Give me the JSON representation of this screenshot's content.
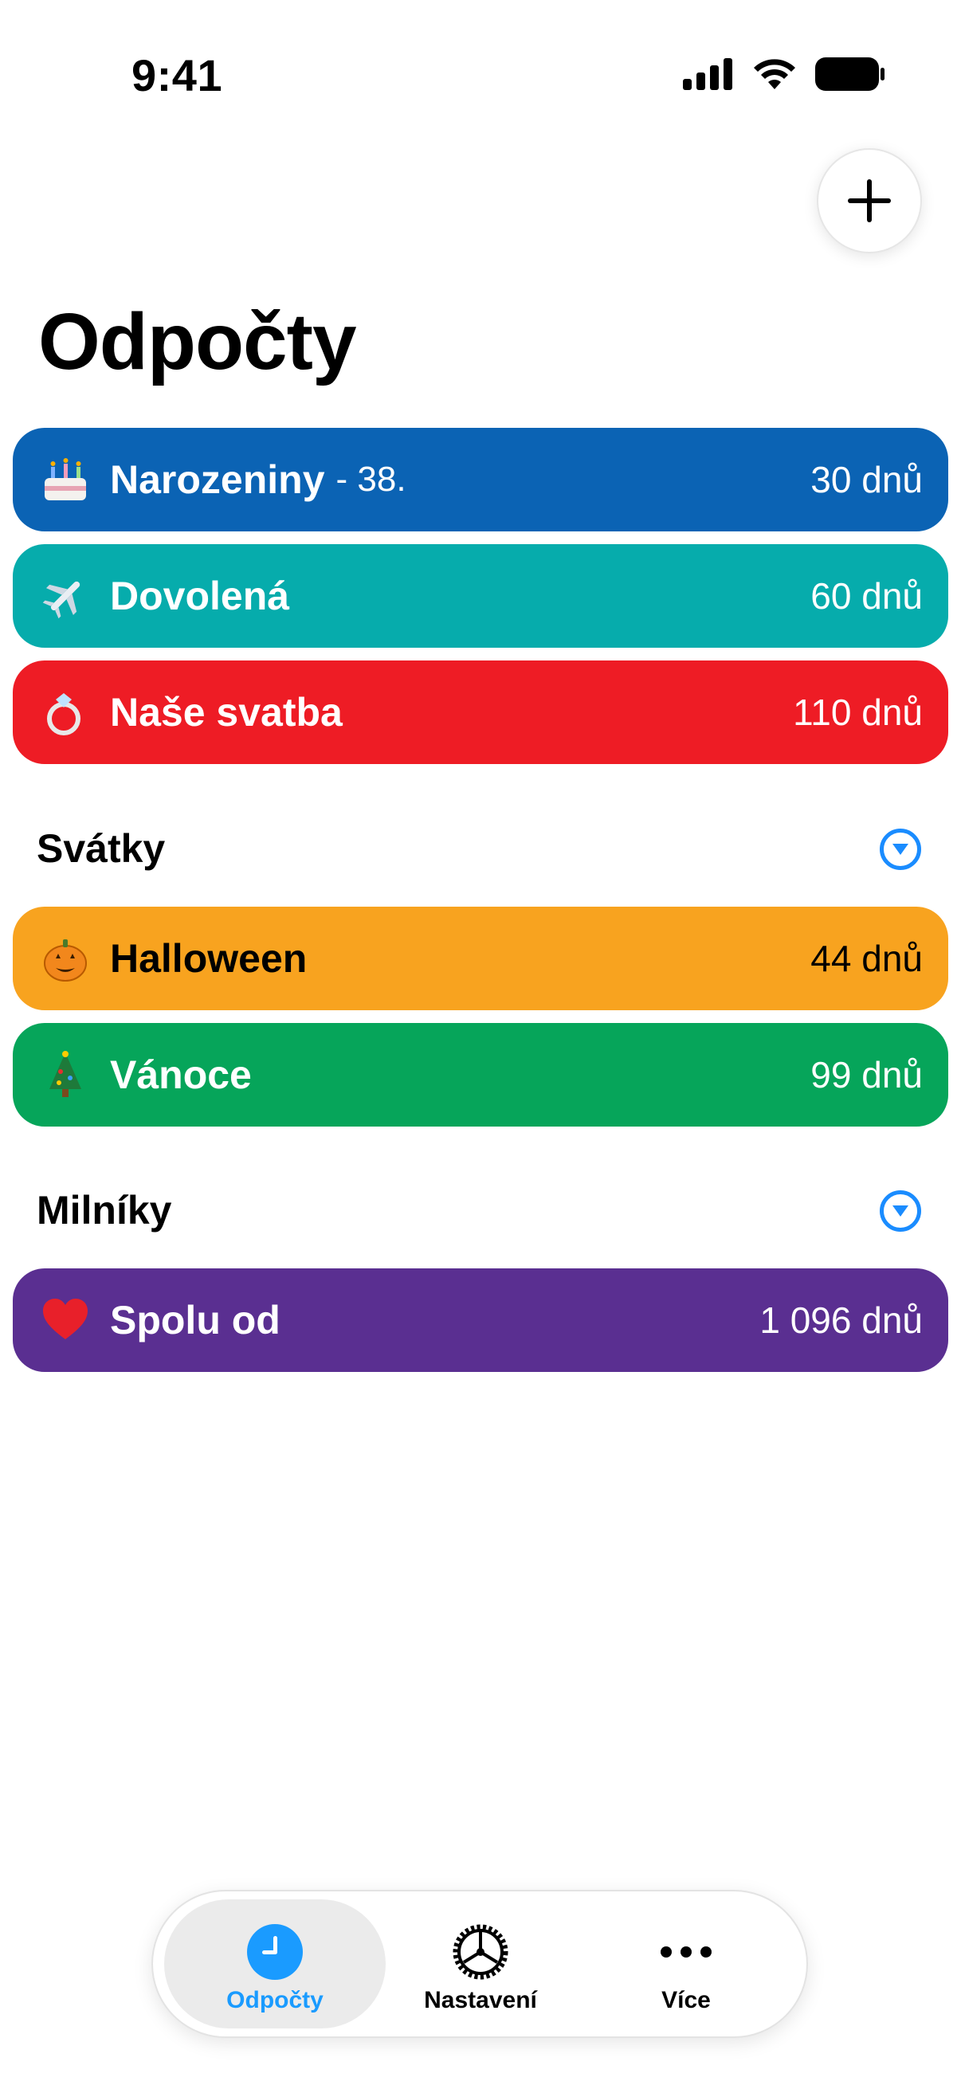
{
  "status": {
    "time": "9:41"
  },
  "header": {
    "title": "Odpočty"
  },
  "countdowns": [
    {
      "emoji": "🎂",
      "name": "Narozeniny",
      "suffix": "- 38.",
      "days": "30 dnů",
      "color": "#0B63B4",
      "text_color": "#ffffff"
    },
    {
      "emoji": "✈️",
      "name": "Dovolená",
      "days": "60 dnů",
      "color": "#06ACAC",
      "text_color": "#ffffff"
    },
    {
      "emoji": "💍",
      "name": "Naše svatba",
      "days": "110 dnů",
      "color": "#EE1C25",
      "text_color": "#ffffff"
    }
  ],
  "sections": [
    {
      "title": "Svátky",
      "items": [
        {
          "emoji": "🎃",
          "name": "Halloween",
          "days": "44 dnů",
          "color": "#F8A31F",
          "text_color": "#000000"
        },
        {
          "emoji": "🎄",
          "name": "Vánoce",
          "days": "99 dnů",
          "color": "#06A55A",
          "text_color": "#ffffff"
        }
      ]
    },
    {
      "title": "Milníky",
      "items": [
        {
          "emoji": "❤️",
          "name": "Spolu od",
          "days": "1 096 dnů",
          "color": "#5A2F91",
          "text_color": "#ffffff"
        }
      ]
    }
  ],
  "tabbar": {
    "tabs": [
      {
        "label": "Odpočty",
        "icon": "clock-icon",
        "active": true,
        "color": "#1a9bff"
      },
      {
        "label": "Nastavení",
        "icon": "gear-icon",
        "active": false
      },
      {
        "label": "Více",
        "icon": "ellipsis-icon",
        "active": false
      }
    ]
  },
  "accent": "#1a8cff"
}
